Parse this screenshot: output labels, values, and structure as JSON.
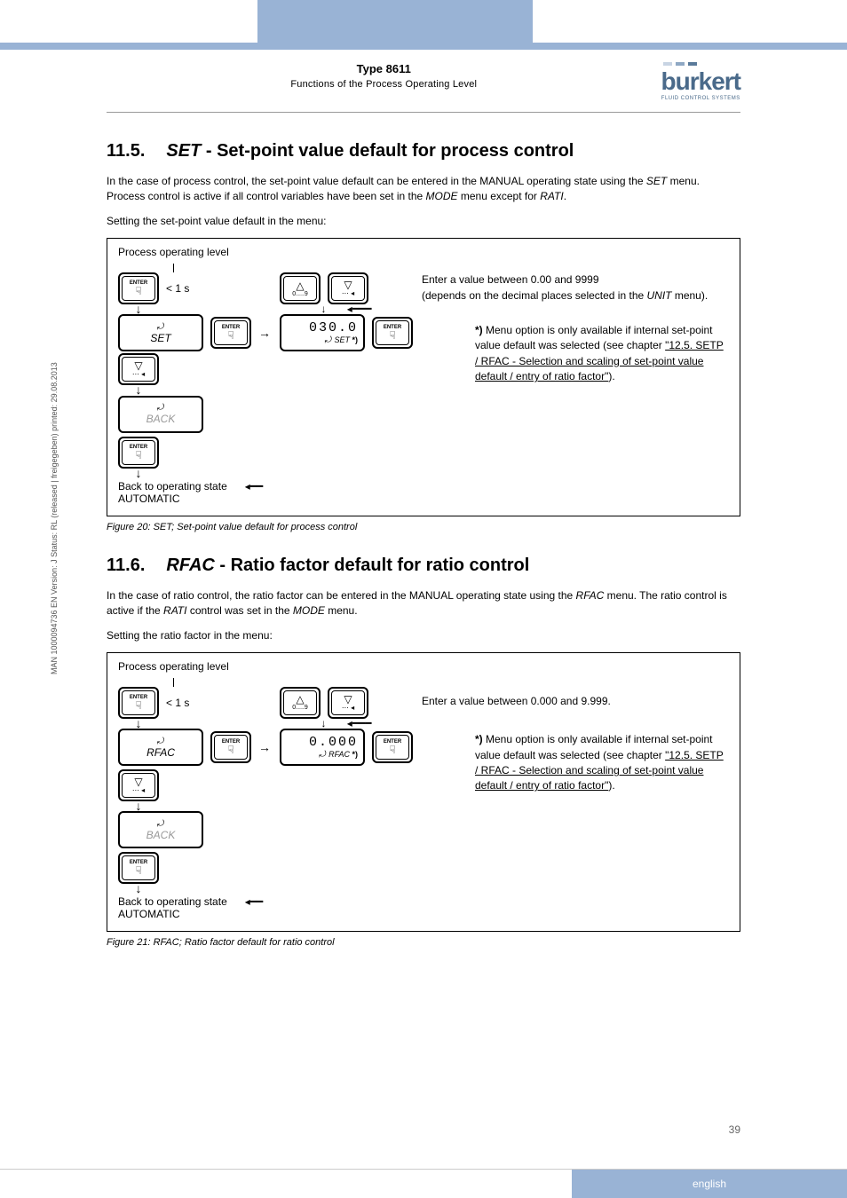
{
  "header": {
    "type_label": "Type 8611",
    "subtitle": "Functions of the Process Operating Level",
    "logo_text": "burkert",
    "logo_sub": "FLUID CONTROL SYSTEMS"
  },
  "section_115": {
    "number": "11.5.",
    "title_italic": "SET",
    "title_rest": " - Set-point value default for process control",
    "para1_a": "In the case of process control, the set-point value default can be entered in the MANUAL operating state using the ",
    "para1_set": "SET",
    "para1_b": " menu.",
    "para2_a": "Process control is active if all control variables have been set in the ",
    "para2_mode": "MODE",
    "para2_b": " menu except for ",
    "para2_rati": "RATI",
    "para2_c": ".",
    "para3": "Setting the set-point value default in the menu:",
    "diagram": {
      "title": "Process operating level",
      "duration": "< 1 s",
      "key_range": "0.....9",
      "set_label": "SET",
      "display_value": "030.0",
      "display_label": "SET",
      "back_label": "BACK",
      "back_text1": "Back to operating state",
      "back_text2": "AUTOMATIC",
      "hint_a": "Enter a value between 0.00 and 9999",
      "hint_b": "(depends on the decimal places selected in the ",
      "hint_unit": "UNIT",
      "hint_c": " menu).",
      "note_ast": "*)",
      "note_a": " Menu option is only available if internal set-point value default was selected (see chapter ",
      "note_link": "\"12.5. SETP / RFAC - Selection and scaling of set-point value default / entry of ratio factor\"",
      "note_b": ").",
      "enter_label": "ENTER"
    },
    "caption": "Figure 20:      SET; Set-point value default for process control"
  },
  "section_116": {
    "number": "11.6.",
    "title_italic": "RFAC",
    "title_rest": " - Ratio factor default for ratio control",
    "para1_a": "In the case of ratio control, the ratio factor can be entered in the MANUAL operating state using the ",
    "para1_rfac": "RFAC",
    "para1_b": " menu. The ratio control is active if the ",
    "para1_rati": "RATI",
    "para1_c": " control was set in the ",
    "para1_mode": "MODE",
    "para1_d": " menu.",
    "para2": "Setting the ratio factor in the menu:",
    "diagram": {
      "title": "Process operating level",
      "duration": "< 1 s",
      "key_range": "0.....9",
      "rfac_label": "RFAC",
      "display_value": "0.000",
      "display_label": "RFAC",
      "back_label": "BACK",
      "back_text1": "Back to operating state",
      "back_text2": "AUTOMATIC",
      "hint": "Enter a value between 0.000 and 9.999.",
      "note_ast": "*)",
      "note_a": " Menu option is only available if internal set-point value default was selected (see chapter ",
      "note_link": "\"12.5. SETP / RFAC - Selection and scaling of set-point value default / entry of ratio factor\"",
      "note_b": ").",
      "enter_label": "ENTER"
    },
    "caption": "Figure 21:      RFAC; Ratio factor default for ratio control"
  },
  "side_text": "MAN 1000094736 EN Version: J Status: RL (released | freigegeben) printed: 29.08.2013",
  "page_num": "39",
  "footer": "english"
}
